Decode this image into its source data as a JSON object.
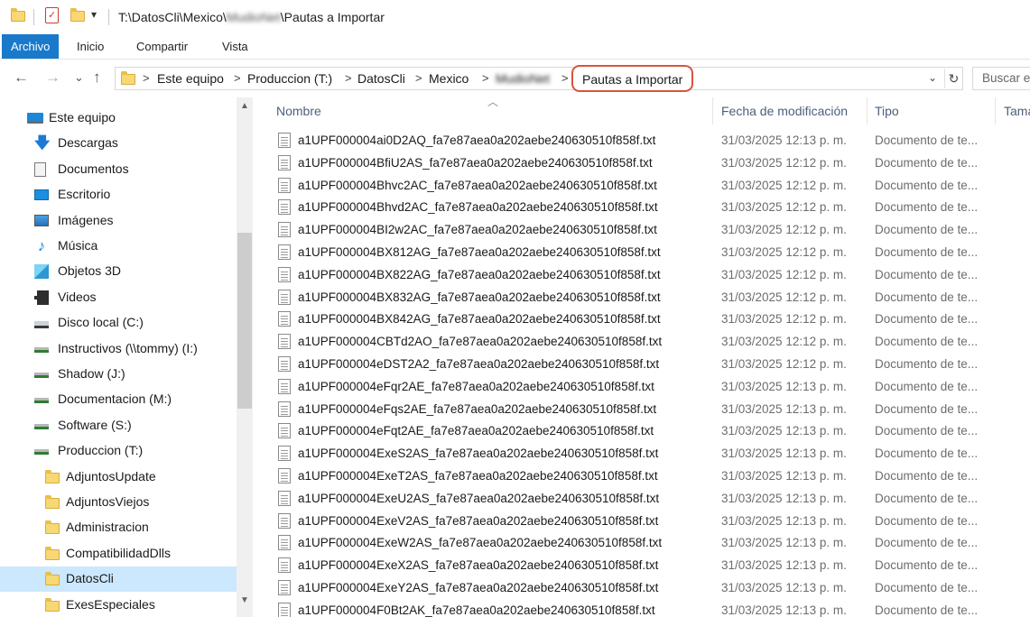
{
  "window": {
    "title_prefix": "T:\\DatosCli\\Mexico\\",
    "title_blurred": "MudioNet",
    "title_suffix": "\\Pautas a Importar",
    "qa_dropdown": "▾"
  },
  "ribbon": {
    "tabs": [
      "Archivo",
      "Inicio",
      "Compartir",
      "Vista"
    ]
  },
  "address": {
    "back": "←",
    "forward": "→",
    "recent": "⌄",
    "up": "↑",
    "crumbs": [
      "Este equipo",
      "Produccion (T:)",
      "DatosCli",
      "Mexico"
    ],
    "crumb_blurred": "MudioNet",
    "separator": ">",
    "current": "Pautas a Importar",
    "dropdown": "⌄",
    "refresh": "↻",
    "search_placeholder": "Buscar e"
  },
  "nav": {
    "items": [
      {
        "label": "Este equipo",
        "icon": "computer-icon"
      },
      {
        "label": "Descargas",
        "icon": "download-icon"
      },
      {
        "label": "Documentos",
        "icon": "document-icon"
      },
      {
        "label": "Escritorio",
        "icon": "desktop-icon"
      },
      {
        "label": "Imágenes",
        "icon": "pictures-icon"
      },
      {
        "label": "Música",
        "icon": "music-icon"
      },
      {
        "label": "Objetos 3D",
        "icon": "3d-objects-icon"
      },
      {
        "label": "Videos",
        "icon": "videos-icon"
      },
      {
        "label": "Disco local (C:)",
        "icon": "local-disk-icon"
      },
      {
        "label": "Instructivos (\\\\tommy) (I:)",
        "icon": "network-drive-icon"
      },
      {
        "label": "Shadow (J:)",
        "icon": "network-drive-icon"
      },
      {
        "label": "Documentacion (M:)",
        "icon": "network-drive-icon"
      },
      {
        "label": "Software (S:)",
        "icon": "network-drive-icon"
      },
      {
        "label": "Produccion (T:)",
        "icon": "network-drive-icon"
      },
      {
        "label": "AdjuntosUpdate",
        "icon": "folder-icon"
      },
      {
        "label": "AdjuntosViejos",
        "icon": "folder-icon"
      },
      {
        "label": "Administracion",
        "icon": "folder-icon"
      },
      {
        "label": "CompatibilidadDlls",
        "icon": "folder-icon"
      },
      {
        "label": "DatosCli",
        "icon": "folder-icon",
        "selected": true
      },
      {
        "label": "ExesEspeciales",
        "icon": "folder-icon"
      }
    ],
    "scroll_up": "▲",
    "scroll_down": "▼"
  },
  "filelist": {
    "sort_caret": "︿",
    "columns": [
      "Nombre",
      "Fecha de modificación",
      "Tipo",
      "Tama"
    ],
    "rows": [
      {
        "name": "a1UPF000004ai0D2AQ_fa7e87aea0a202aebe240630510f858f.txt",
        "date": "31/03/2025 12:13 p. m.",
        "type": "Documento de te..."
      },
      {
        "name": "a1UPF000004BfiU2AS_fa7e87aea0a202aebe240630510f858f.txt",
        "date": "31/03/2025 12:12 p. m.",
        "type": "Documento de te..."
      },
      {
        "name": "a1UPF000004Bhvc2AC_fa7e87aea0a202aebe240630510f858f.txt",
        "date": "31/03/2025 12:12 p. m.",
        "type": "Documento de te..."
      },
      {
        "name": "a1UPF000004Bhvd2AC_fa7e87aea0a202aebe240630510f858f.txt",
        "date": "31/03/2025 12:12 p. m.",
        "type": "Documento de te..."
      },
      {
        "name": "a1UPF000004BI2w2AC_fa7e87aea0a202aebe240630510f858f.txt",
        "date": "31/03/2025 12:12 p. m.",
        "type": "Documento de te..."
      },
      {
        "name": "a1UPF000004BX812AG_fa7e87aea0a202aebe240630510f858f.txt",
        "date": "31/03/2025 12:12 p. m.",
        "type": "Documento de te..."
      },
      {
        "name": "a1UPF000004BX822AG_fa7e87aea0a202aebe240630510f858f.txt",
        "date": "31/03/2025 12:12 p. m.",
        "type": "Documento de te..."
      },
      {
        "name": "a1UPF000004BX832AG_fa7e87aea0a202aebe240630510f858f.txt",
        "date": "31/03/2025 12:12 p. m.",
        "type": "Documento de te..."
      },
      {
        "name": "a1UPF000004BX842AG_fa7e87aea0a202aebe240630510f858f.txt",
        "date": "31/03/2025 12:12 p. m.",
        "type": "Documento de te..."
      },
      {
        "name": "a1UPF000004CBTd2AO_fa7e87aea0a202aebe240630510f858f.txt",
        "date": "31/03/2025 12:12 p. m.",
        "type": "Documento de te..."
      },
      {
        "name": "a1UPF000004eDST2A2_fa7e87aea0a202aebe240630510f858f.txt",
        "date": "31/03/2025 12:12 p. m.",
        "type": "Documento de te..."
      },
      {
        "name": "a1UPF000004eFqr2AE_fa7e87aea0a202aebe240630510f858f.txt",
        "date": "31/03/2025 12:13 p. m.",
        "type": "Documento de te..."
      },
      {
        "name": "a1UPF000004eFqs2AE_fa7e87aea0a202aebe240630510f858f.txt",
        "date": "31/03/2025 12:13 p. m.",
        "type": "Documento de te..."
      },
      {
        "name": "a1UPF000004eFqt2AE_fa7e87aea0a202aebe240630510f858f.txt",
        "date": "31/03/2025 12:13 p. m.",
        "type": "Documento de te..."
      },
      {
        "name": "a1UPF000004ExeS2AS_fa7e87aea0a202aebe240630510f858f.txt",
        "date": "31/03/2025 12:13 p. m.",
        "type": "Documento de te..."
      },
      {
        "name": "a1UPF000004ExeT2AS_fa7e87aea0a202aebe240630510f858f.txt",
        "date": "31/03/2025 12:13 p. m.",
        "type": "Documento de te..."
      },
      {
        "name": "a1UPF000004ExeU2AS_fa7e87aea0a202aebe240630510f858f.txt",
        "date": "31/03/2025 12:13 p. m.",
        "type": "Documento de te..."
      },
      {
        "name": "a1UPF000004ExeV2AS_fa7e87aea0a202aebe240630510f858f.txt",
        "date": "31/03/2025 12:13 p. m.",
        "type": "Documento de te..."
      },
      {
        "name": "a1UPF000004ExeW2AS_fa7e87aea0a202aebe240630510f858f.txt",
        "date": "31/03/2025 12:13 p. m.",
        "type": "Documento de te..."
      },
      {
        "name": "a1UPF000004ExeX2AS_fa7e87aea0a202aebe240630510f858f.txt",
        "date": "31/03/2025 12:13 p. m.",
        "type": "Documento de te..."
      },
      {
        "name": "a1UPF000004ExeY2AS_fa7e87aea0a202aebe240630510f858f.txt",
        "date": "31/03/2025 12:13 p. m.",
        "type": "Documento de te..."
      },
      {
        "name": "a1UPF000004F0Bt2AK_fa7e87aea0a202aebe240630510f858f.txt",
        "date": "31/03/2025 12:13 p. m.",
        "type": "Documento de te..."
      }
    ]
  },
  "colors": {
    "accent": "#1979ca",
    "highlight_ring": "#d9543e",
    "selection": "#cce8ff",
    "folder": "#f8d775"
  }
}
